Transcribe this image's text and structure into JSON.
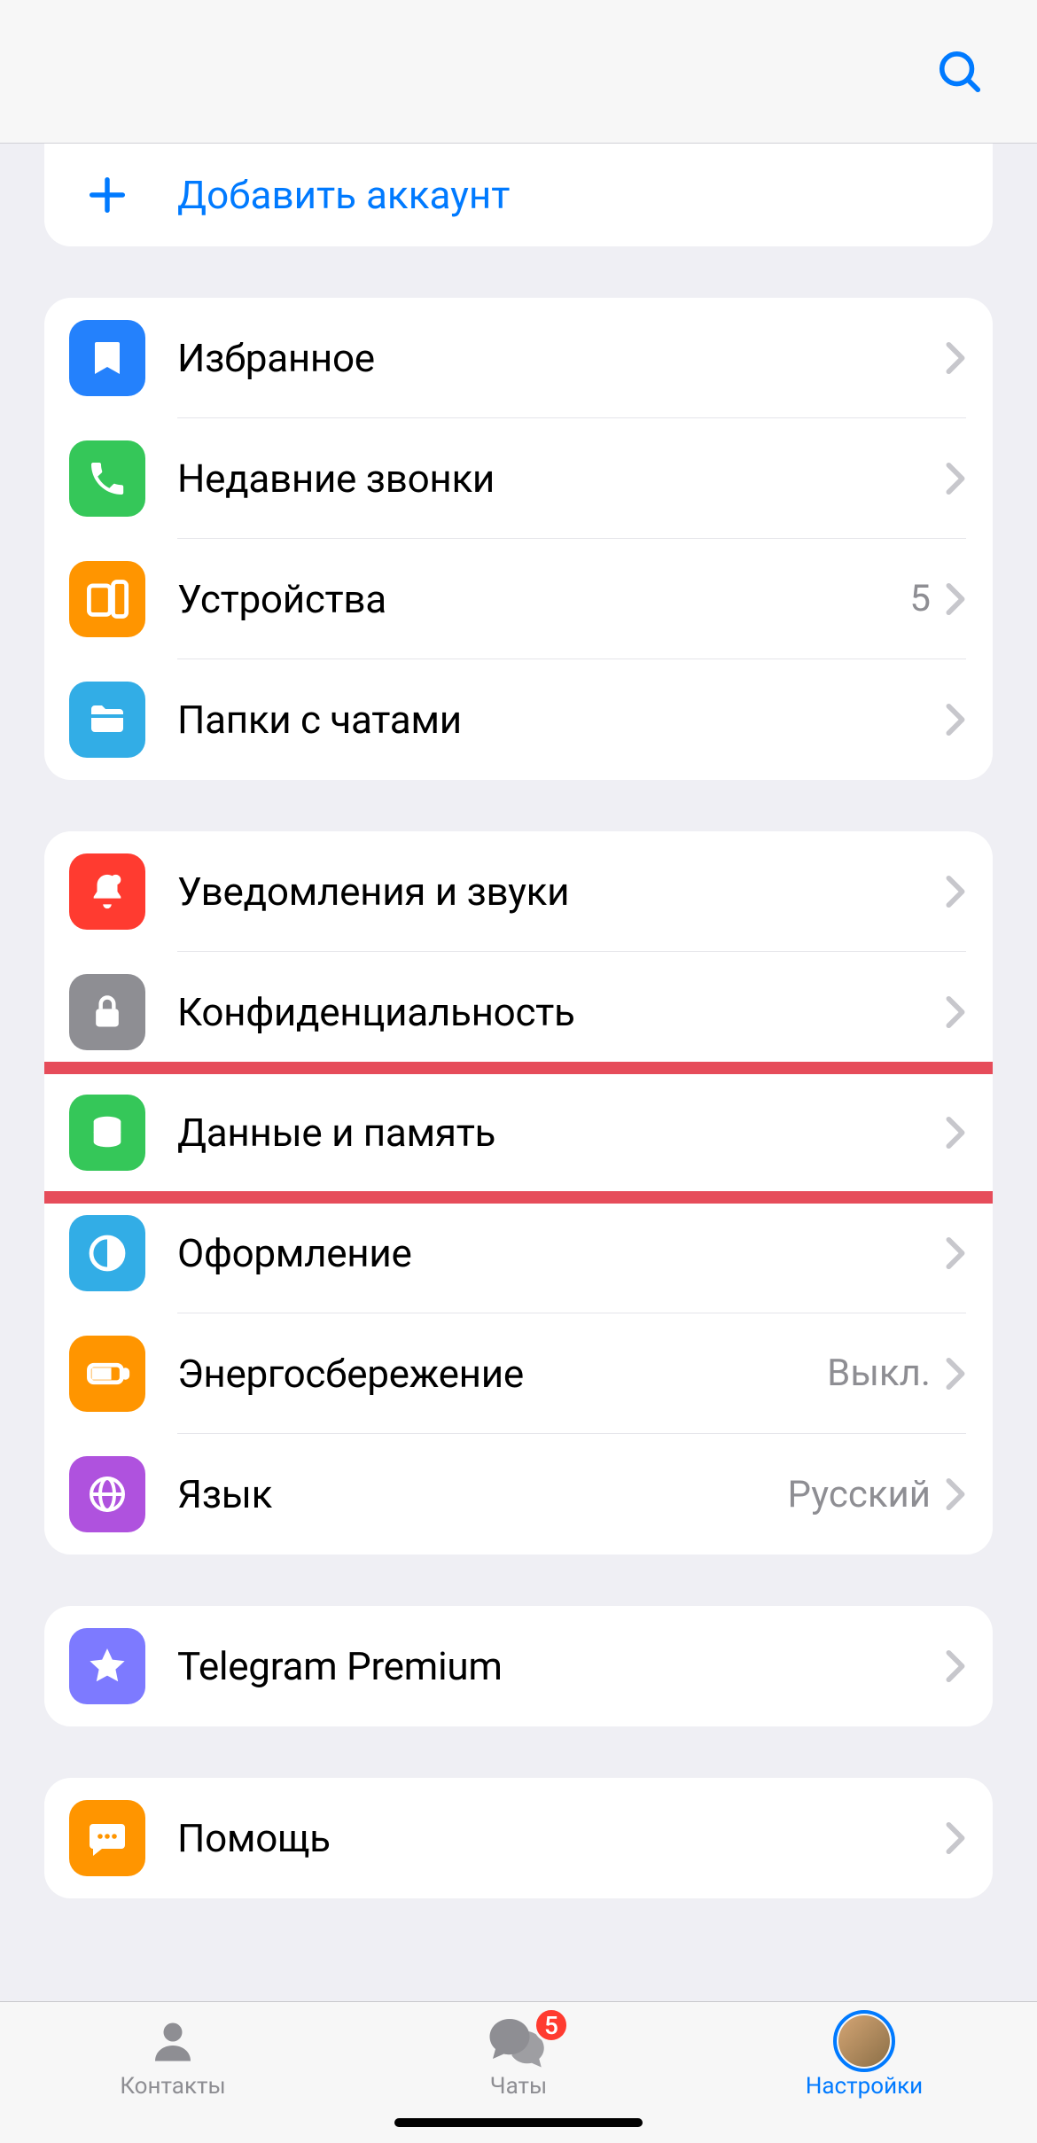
{
  "accent": "#007aff",
  "add_account": {
    "label": "Добавить аккаунт"
  },
  "groups": [
    {
      "rows": [
        {
          "id": "saved",
          "icon": "bookmark",
          "bg": "#2481fc",
          "label": "Избранное",
          "value": ""
        },
        {
          "id": "calls",
          "icon": "phone",
          "bg": "#35c759",
          "label": "Недавние звонки",
          "value": ""
        },
        {
          "id": "devices",
          "icon": "devices",
          "bg": "#ff9500",
          "label": "Устройства",
          "value": "5"
        },
        {
          "id": "folders",
          "icon": "folder",
          "bg": "#32ade6",
          "label": "Папки с чатами",
          "value": ""
        }
      ]
    },
    {
      "rows": [
        {
          "id": "notifications",
          "icon": "bell",
          "bg": "#ff3b30",
          "label": "Уведомления и звуки",
          "value": ""
        },
        {
          "id": "privacy",
          "icon": "lock",
          "bg": "#8e8e93",
          "label": "Конфиденциальность",
          "value": ""
        },
        {
          "id": "storage",
          "icon": "database",
          "bg": "#35c759",
          "label": "Данные и память",
          "value": "",
          "highlighted": true
        },
        {
          "id": "appearance",
          "icon": "circle-half",
          "bg": "#32ade6",
          "label": "Оформление",
          "value": ""
        },
        {
          "id": "power",
          "icon": "battery",
          "bg": "#ff9500",
          "label": "Энергосбережение",
          "value": "Выкл."
        },
        {
          "id": "language",
          "icon": "globe",
          "bg": "#af52de",
          "label": "Язык",
          "value": "Русский"
        }
      ]
    },
    {
      "rows": [
        {
          "id": "premium",
          "icon": "star",
          "bg": "#7d7aff",
          "label": "Telegram Premium",
          "value": ""
        }
      ]
    },
    {
      "rows": [
        {
          "id": "help",
          "icon": "chat",
          "bg": "#ff9500",
          "label": "Помощь",
          "value": ""
        }
      ]
    }
  ],
  "tabs": {
    "contacts": "Контакты",
    "chats": "Чаты",
    "chats_badge": "5",
    "settings": "Настройки"
  }
}
